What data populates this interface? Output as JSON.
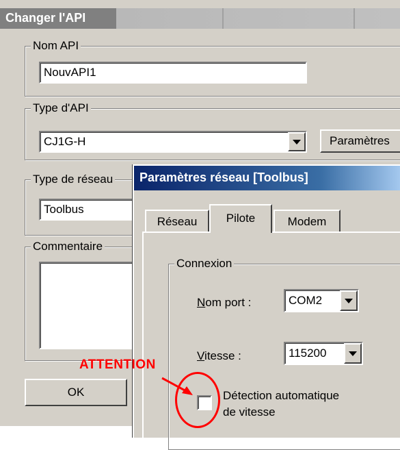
{
  "main_dialog": {
    "title": "Changer l'API",
    "groups": {
      "nom_api": {
        "legend": "Nom API",
        "value": "NouvAPI1"
      },
      "type_api": {
        "legend": "Type d'API",
        "value": "CJ1G-H",
        "button": "Paramètres"
      },
      "type_reseau": {
        "legend": "Type de réseau",
        "value": "Toolbus"
      },
      "commentaire": {
        "legend": "Commentaire",
        "value": ""
      }
    },
    "ok_button": "OK"
  },
  "sub_dialog": {
    "title": "Paramètres réseau [Toolbus]",
    "tabs": [
      "Réseau",
      "Pilote",
      "Modem"
    ],
    "active_tab": "Pilote",
    "connexion": {
      "legend": "Connexion",
      "port_label_accel": "N",
      "port_label_rest": "om port :",
      "port_value": "COM2",
      "speed_label_accel": "V",
      "speed_label_rest": "itesse :",
      "speed_value": "115200",
      "auto_detect_line1": "Détection automatique",
      "auto_detect_line2": "de vitesse",
      "auto_detect_checked": false
    }
  },
  "annotation": {
    "text": "ATTENTION",
    "color": "#ff0000"
  }
}
